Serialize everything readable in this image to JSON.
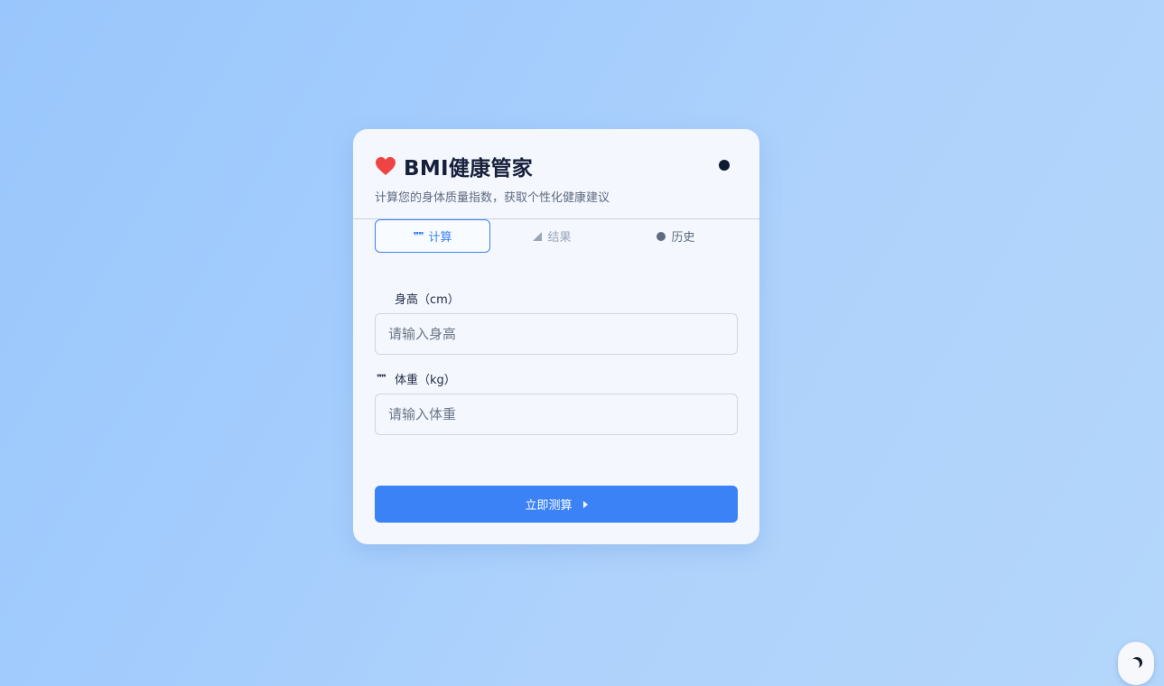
{
  "app": {
    "title": "BMI健康管家",
    "subtitle": "计算您的身体质量指数，获取个性化健康建议"
  },
  "tabs": [
    {
      "label": "计算",
      "icon": "quote-icon",
      "active": true
    },
    {
      "label": "结果",
      "icon": "chart-icon",
      "active": false
    },
    {
      "label": "历史",
      "icon": "history-icon",
      "active": false
    }
  ],
  "form": {
    "height": {
      "label": "身高（cm）",
      "placeholder": "请输入身高",
      "value": ""
    },
    "weight": {
      "label": "体重（kg）",
      "placeholder": "请输入体重",
      "value": "",
      "icon": "quote-icon"
    },
    "submit_label": "立即测算"
  },
  "icons": {
    "heart": "heart-icon",
    "theme_toggle": "circle-icon",
    "dark_mode": "moon-icon",
    "submit_arrow": "caret-right-icon"
  },
  "colors": {
    "accent": "#3b82f6",
    "heart": "#ef4444",
    "title": "#16203a",
    "card_bg": "#f4f7fd"
  }
}
